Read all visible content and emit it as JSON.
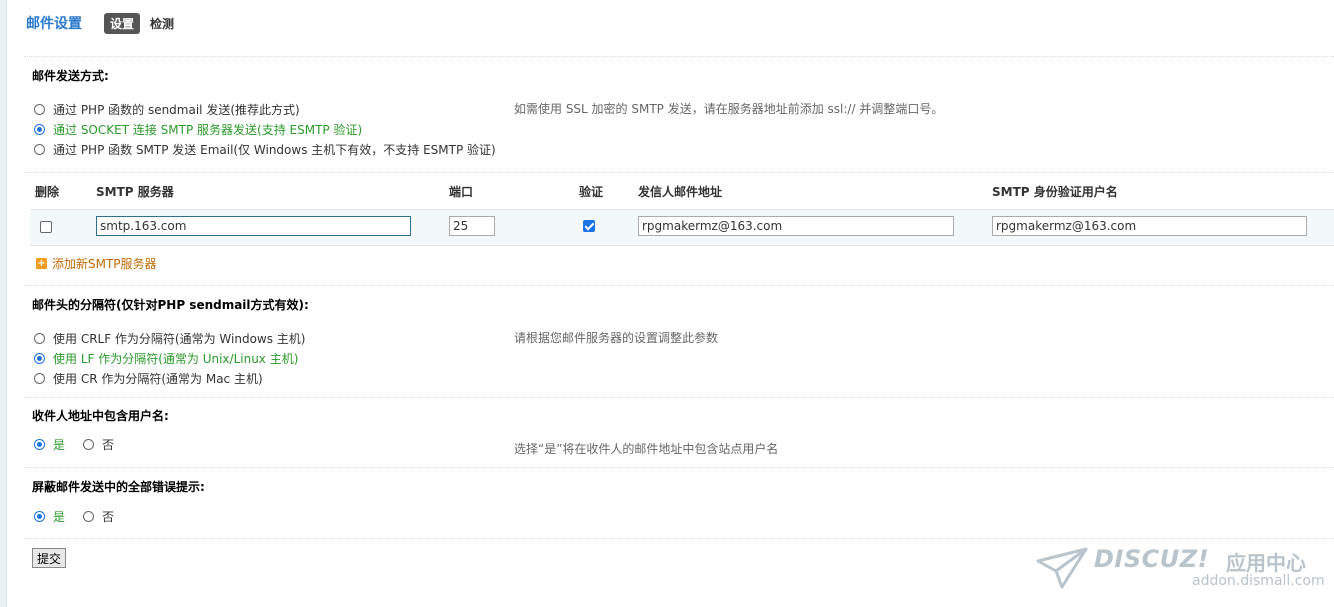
{
  "header": {
    "title": "邮件设置",
    "tabs": [
      {
        "label": "设置",
        "active": true
      },
      {
        "label": "检测",
        "active": false
      }
    ]
  },
  "send_method": {
    "title": "邮件发送方式:",
    "options": [
      {
        "label": "通过 PHP 函数的 sendmail 发送(推荐此方式)",
        "selected": false
      },
      {
        "label": "通过 SOCKET 连接 SMTP 服务器发送(支持 ESMTP 验证)",
        "selected": true
      },
      {
        "label": "通过 PHP 函数 SMTP 发送 Email(仅 Windows 主机下有效，不支持 ESMTP 验证)",
        "selected": false
      }
    ],
    "hint": "如需使用 SSL 加密的 SMTP 发送，请在服务器地址前添加 ssl:// 并调整端口号。"
  },
  "smtp_table": {
    "headers": {
      "delete": "删除",
      "server": "SMTP 服务器",
      "port": "端口",
      "auth": "验证",
      "from": "发信人邮件地址",
      "user": "SMTP 身份验证用户名"
    },
    "rows": [
      {
        "delete": false,
        "server": "smtp.163.com",
        "port": "25",
        "auth": true,
        "from": "rpgmakermz@163.com",
        "user": "rpgmakermz@163.com"
      }
    ],
    "add_label": "添加新SMTP服务器"
  },
  "separator": {
    "title": "邮件头的分隔符(仅针对PHP sendmail方式有效):",
    "options": [
      {
        "label": "使用 CRLF 作为分隔符(通常为 Windows 主机)",
        "selected": false
      },
      {
        "label": "使用 LF 作为分隔符(通常为 Unix/Linux 主机)",
        "selected": true
      },
      {
        "label": "使用 CR 作为分隔符(通常为 Mac 主机)",
        "selected": false
      }
    ],
    "hint": "请根据您邮件服务器的设置调整此参数"
  },
  "include_username": {
    "title": "收件人地址中包含用户名:",
    "yes": "是",
    "no": "否",
    "value": "yes",
    "hint": "选择“是”将在收件人的邮件地址中包含站点用户名"
  },
  "silent_errors": {
    "title": "屏蔽邮件发送中的全部错误提示:",
    "yes": "是",
    "no": "否",
    "value": "yes"
  },
  "submit_label": "提交",
  "watermark": {
    "brand": "DISCUZ!",
    "app": "应用中心",
    "url": "addon.dismall.com"
  },
  "colors": {
    "title": "#2b7acd",
    "selected_option": "#2a9a2a",
    "link": "#c26a00"
  }
}
